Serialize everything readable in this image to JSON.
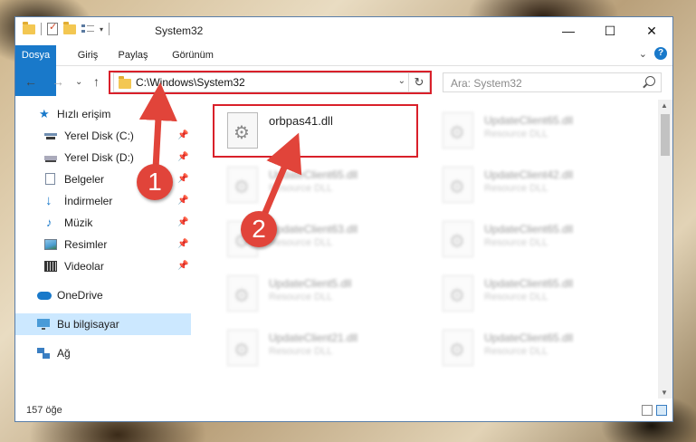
{
  "window": {
    "title": "System32"
  },
  "titlebar": {
    "buttons": {
      "minimize": "—",
      "maximize": "☐",
      "close": "✕"
    }
  },
  "ribbon": {
    "tabs": [
      "Dosya",
      "Giriş",
      "Paylaş",
      "Görünüm"
    ],
    "expand": "⌄",
    "help": "?"
  },
  "navigation": {
    "back": "←",
    "forward": "→",
    "recent": "⌄",
    "up": "↑",
    "address": "C:\\Windows\\System32",
    "address_dropdown": "⌄",
    "refresh": "↻",
    "search_placeholder": "Ara: System32"
  },
  "sidebar": {
    "items": [
      {
        "label": "Hızlı erişim",
        "icon": "star-icon"
      },
      {
        "label": "Yerel Disk (C:)",
        "icon": "drive-icon",
        "pinned": true
      },
      {
        "label": "Yerel Disk (D:)",
        "icon": "drive-icon",
        "pinned": true
      },
      {
        "label": "Belgeler",
        "icon": "document-icon",
        "pinned": true
      },
      {
        "label": "İndirmeler",
        "icon": "download-icon",
        "pinned": true
      },
      {
        "label": "Müzik",
        "icon": "music-icon",
        "pinned": true
      },
      {
        "label": "Resimler",
        "icon": "pictures-icon",
        "pinned": true
      },
      {
        "label": "Videolar",
        "icon": "video-icon",
        "pinned": true
      },
      {
        "label": "OneDrive",
        "icon": "onedrive-icon"
      },
      {
        "label": "Bu bilgisayar",
        "icon": "computer-icon",
        "selected": true
      },
      {
        "label": "Ağ",
        "icon": "network-icon"
      }
    ],
    "pin_glyph": "📌"
  },
  "files": [
    {
      "name": "orbpas41.dll",
      "type": ""
    },
    {
      "name": "UpdateClient65.dll",
      "type": "Resource DLL"
    },
    {
      "name": "UpdateClient65.dll",
      "type": "Resource DLL"
    },
    {
      "name": "UpdateClient42.dll",
      "type": "Resource DLL"
    },
    {
      "name": "UpdateClient63.dll",
      "type": "Resource DLL"
    },
    {
      "name": "UpdateClient65.dll",
      "type": "Resource DLL"
    },
    {
      "name": "UpdateClient5.dll",
      "type": "Resource DLL"
    },
    {
      "name": "UpdateClient65.dll",
      "type": "Resource DLL"
    },
    {
      "name": "UpdateClient21.dll",
      "type": "Resource DLL"
    },
    {
      "name": "UpdateClient65.dll",
      "type": "Resource DLL"
    }
  ],
  "status": {
    "count": "157 öğe"
  },
  "annotations": {
    "step1": "1",
    "step2": "2",
    "color": "#e1443a"
  }
}
